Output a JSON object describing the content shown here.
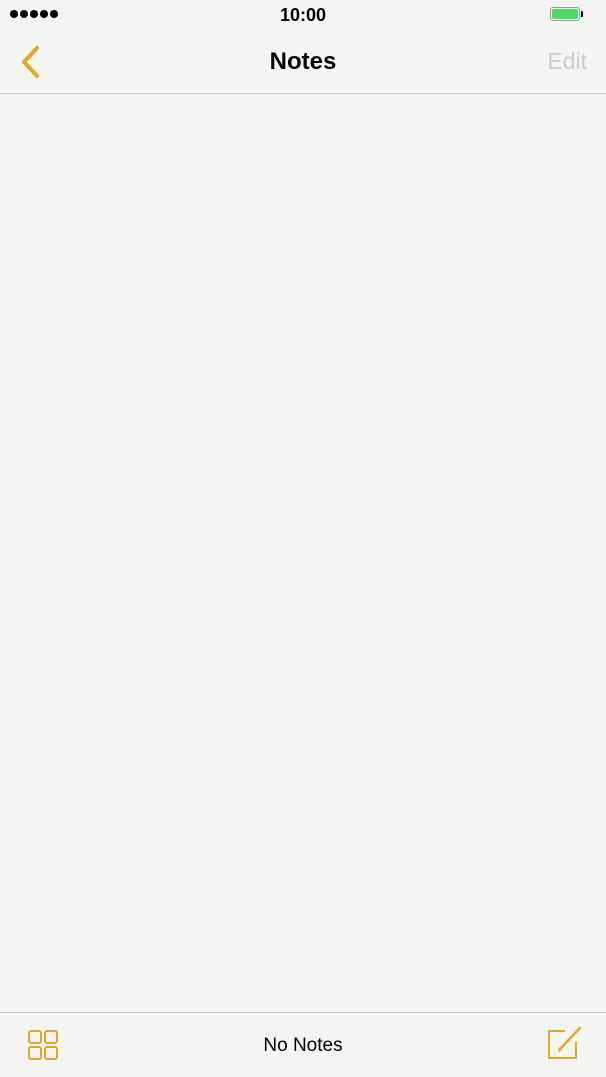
{
  "status_bar": {
    "time": "10:00",
    "signal_bars": 5,
    "battery_level": 1.0,
    "battery_color": "#4cd964"
  },
  "nav_bar": {
    "back_icon": "chevron-left-icon",
    "title": "Notes",
    "edit_label": "Edit"
  },
  "toolbar": {
    "gallery_icon": "grid-view-icon",
    "status_text": "No Notes",
    "compose_icon": "compose-icon"
  },
  "colors": {
    "accent": "#e0a825",
    "background": "#f4f4f3",
    "disabled_text": "#cdcdcd"
  }
}
